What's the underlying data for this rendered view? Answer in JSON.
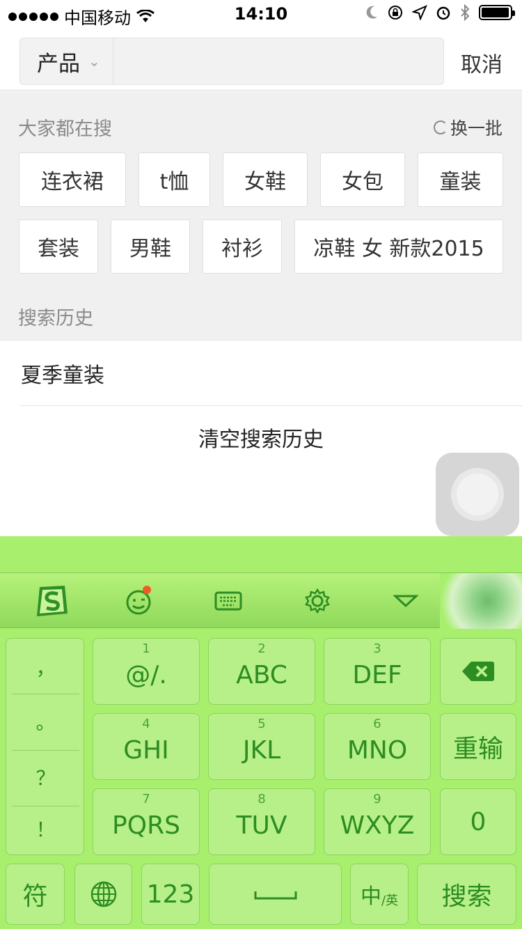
{
  "status_bar": {
    "carrier": "中国移动",
    "time": "14:10"
  },
  "search": {
    "category": "产品",
    "cancel_label": "取消",
    "input_value": ""
  },
  "hot": {
    "title": "大家都在搜",
    "refresh_label": "换一批",
    "tags": [
      "连衣裙",
      "t恤",
      "女鞋",
      "女包",
      "童装",
      "套装",
      "男鞋",
      "衬衫",
      "凉鞋 女 新款2015"
    ]
  },
  "history": {
    "title": "搜索历史",
    "items": [
      "夏季童装"
    ],
    "clear_label": "清空搜索历史"
  },
  "keyboard": {
    "punctuation": [
      "，",
      "。",
      "？",
      "！"
    ],
    "keys": [
      {
        "num": "1",
        "label": "@/."
      },
      {
        "num": "2",
        "label": "ABC"
      },
      {
        "num": "3",
        "label": "DEF"
      },
      {
        "num": "4",
        "label": "GHI"
      },
      {
        "num": "5",
        "label": "JKL"
      },
      {
        "num": "6",
        "label": "MNO"
      },
      {
        "num": "7",
        "label": "PQRS"
      },
      {
        "num": "8",
        "label": "TUV"
      },
      {
        "num": "9",
        "label": "WXYZ"
      }
    ],
    "reinput_label": "重输",
    "zero_label": "0",
    "symbol_label": "符",
    "num_label": "123",
    "lang_main": "中",
    "lang_sub": "/英",
    "search_label": "搜索",
    "accent_color": "#2d8c22",
    "bg_color": "#a7ef6d"
  }
}
